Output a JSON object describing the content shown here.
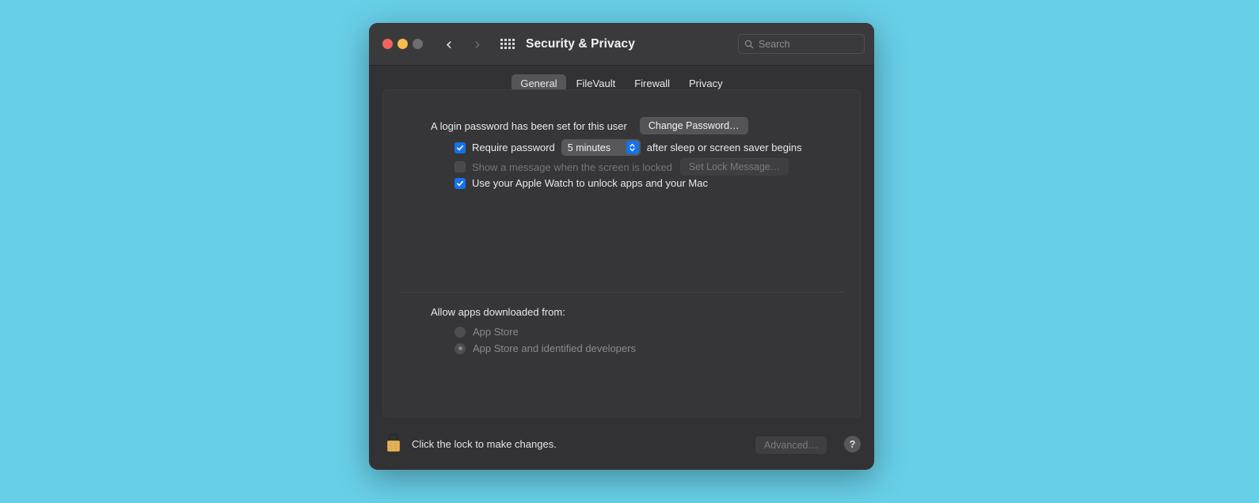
{
  "window": {
    "title": "Security & Privacy",
    "traffic_lights": [
      {
        "name": "close",
        "color": "#f0655d"
      },
      {
        "name": "minimize",
        "color": "#f4bd4e"
      },
      {
        "name": "zoom",
        "color": "#6e6e70"
      }
    ],
    "nav": {
      "back": "‹",
      "forward": "›"
    },
    "grid_button": "show-all",
    "search": {
      "placeholder": "Search",
      "value": ""
    }
  },
  "tabs": [
    {
      "label": "General",
      "selected": true
    },
    {
      "label": "FileVault",
      "selected": false
    },
    {
      "label": "Firewall",
      "selected": false
    },
    {
      "label": "Privacy",
      "selected": false
    }
  ],
  "general": {
    "login_password_text": "A login password has been set for this user",
    "change_password_button": "Change Password…",
    "require_password": {
      "label": "Require password",
      "checked": true,
      "delay_value": "5 minutes",
      "suffix": "after sleep or screen saver begins"
    },
    "show_message": {
      "label": "Show a message when the screen is locked",
      "checked": false,
      "disabled": true,
      "button": "Set Lock Message…"
    },
    "apple_watch": {
      "label": "Use your Apple Watch to unlock apps and your Mac",
      "checked": true
    },
    "allow_apps_label": "Allow apps downloaded from:",
    "allow_apps_options": [
      {
        "label": "App Store",
        "selected": false,
        "disabled": true
      },
      {
        "label": "App Store and identified developers",
        "selected": true,
        "disabled": true
      }
    ]
  },
  "bottom_bar": {
    "lock_state": "locked",
    "lock_caption": "Click the lock to make changes.",
    "advanced_button": "Advanced…",
    "help_button": "?"
  },
  "colors": {
    "desktop_background": "#68cfe8",
    "window_background": "#323234",
    "titlebar_background": "#3a3a3c",
    "pane_background": "#363638",
    "accent_blue": "#1672eb",
    "lock_gold": "#e8b658"
  }
}
